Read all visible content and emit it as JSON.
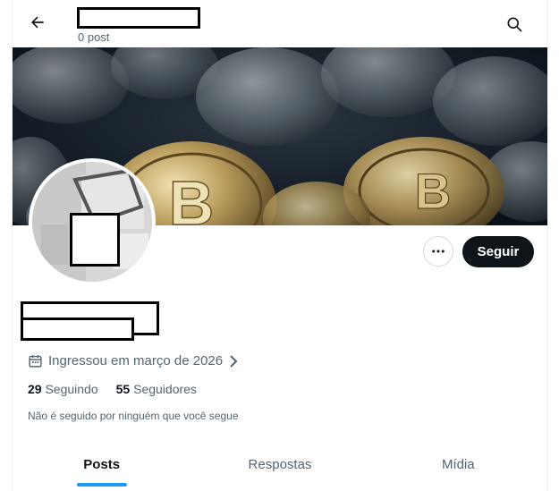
{
  "header": {
    "post_count": "0 post",
    "back_icon": "arrow-left-icon",
    "search_icon": "search-icon"
  },
  "profile": {
    "joined": "Ingressou em março de 2026",
    "following_count": "29",
    "following_label": "Seguindo",
    "followers_count": "55",
    "followers_label": "Seguidores",
    "followed_by_note": "Não é seguido por ninguém que você segue"
  },
  "actions": {
    "follow_label": "Seguir",
    "more_icon": "more-dots-icon"
  },
  "tabs": [
    {
      "label": "Posts",
      "active": true
    },
    {
      "label": "Respostas",
      "active": false
    },
    {
      "label": "Mídia",
      "active": false
    }
  ],
  "colors": {
    "accent": "#1d9bf0",
    "text_primary": "#0f1419",
    "text_secondary": "#536471",
    "follow_button_bg": "#0f1419"
  }
}
